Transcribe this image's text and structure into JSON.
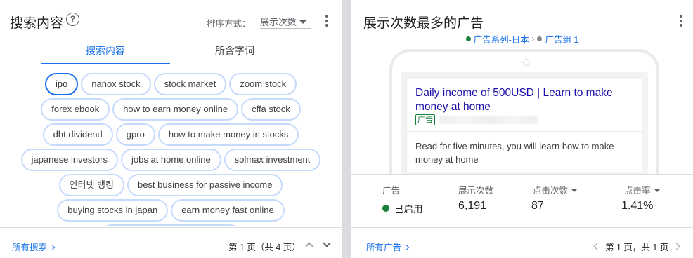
{
  "left": {
    "title": "搜索内容",
    "help_icon": "?",
    "sort_label": "排序方式：",
    "sort_value": "展示次数",
    "tabs": [
      "搜索内容",
      "所含字词"
    ],
    "chip_rows": [
      [
        "ipo",
        "nanox stock",
        "stock market",
        "zoom stock"
      ],
      [
        "forex ebook",
        "how to earn money online",
        "cffa stock"
      ],
      [
        "dht dividend",
        "gpro",
        "how to make money in stocks"
      ],
      [
        "japanese investors",
        "jobs at home online",
        "solmax investment"
      ],
      [
        "인터넷 뱅킹",
        "best business for passive income"
      ],
      [
        "buying stocks in japan",
        "earn money fast online"
      ]
    ],
    "footer_link": "所有搜索",
    "pager": "第 1 页（共 4 页）"
  },
  "right": {
    "title": "展示次数最多的广告",
    "breadcrumb": {
      "campaign": "广告系列-日本",
      "separator": "›",
      "ad_group": "广告组 1"
    },
    "ad": {
      "headline": "Daily income of 500USD | Learn to make money at home",
      "badge": "广告",
      "description": "Read for five minutes, you will learn how to make money at home"
    },
    "stats": {
      "headers": {
        "ad": "广告",
        "impressions": "展示次数",
        "clicks": "点击次数",
        "ctr": "点击率"
      },
      "values": {
        "status": "已启用",
        "impressions": "6,191",
        "clicks": "87",
        "ctr": "1.41%"
      }
    },
    "footer_link": "所有广告",
    "pager": "第 1 页，共 1 页"
  },
  "colors": {
    "accent": "#1a73e8",
    "enabled": "#188038",
    "chip_border": "#c6dafc",
    "ad_headline": "#1a0dab"
  }
}
